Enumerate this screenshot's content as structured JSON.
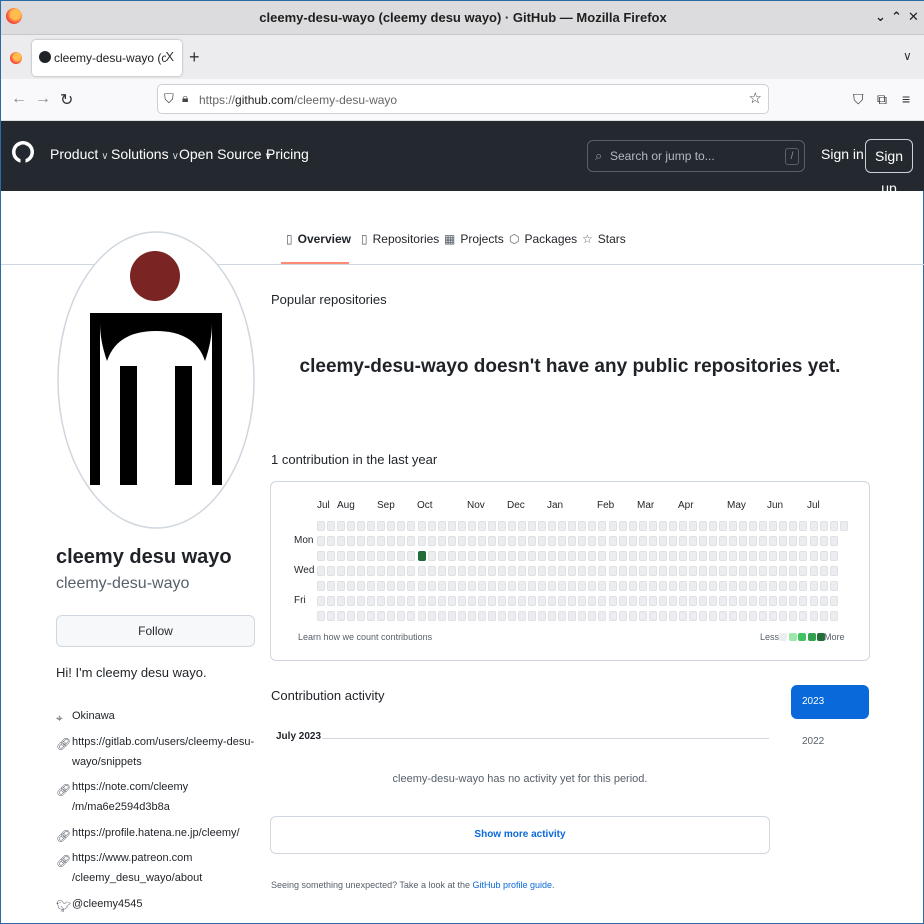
{
  "window": {
    "title": "cleemy-desu-wayo (cleemy desu wayo) · GitHub — Mozilla Firefox",
    "controls": [
      "⌄",
      "⌃",
      "✕"
    ]
  },
  "browser": {
    "tab_label": "cleemy-desu-wayo (cleemy desu",
    "tab_close": "X",
    "new_tab": "+",
    "url_prefix": "https://",
    "url_host": "github.com",
    "url_path": "/cleemy-desu-wayo"
  },
  "github_header": {
    "nav": [
      "Product",
      "Solutions",
      "Open Source",
      "Pricing"
    ],
    "search_placeholder": "Search or jump to...",
    "search_key": "/",
    "sign_in": "Sign in",
    "sign_up": "Sign up"
  },
  "profile_tabs": [
    "Overview",
    "Repositories",
    "Projects",
    "Packages",
    "Stars"
  ],
  "profile": {
    "name": "cleemy desu wayo",
    "login": "cleemy-desu-wayo",
    "follow": "Follow",
    "bio": "Hi! I'm cleemy desu wayo.",
    "location": "Okinawa",
    "links": [
      [
        "https://gitlab.com/users/cleemy-desu-",
        "wayo/snippets"
      ],
      [
        "https://note.com/cleemy",
        "/m/ma6e2594d3b8a"
      ],
      [
        "https://profile.hatena.ne.jp/cleemy/"
      ],
      [
        "https://www.patreon.com",
        "/cleemy_desu_wayo/about"
      ]
    ],
    "twitter": "@cleemy4545",
    "avatar_colors": {
      "head": "#7a2424",
      "body": "#000000"
    }
  },
  "popular": {
    "title": "Popular repositories",
    "empty": "cleemy-desu-wayo doesn't have any public repositories yet."
  },
  "contributions": {
    "title": "1 contribution in the last year",
    "months": [
      "Jul",
      "Aug",
      "Sep",
      "Oct",
      "Nov",
      "Dec",
      "Jan",
      "Feb",
      "Mar",
      "Apr",
      "May",
      "Jun",
      "Jul"
    ],
    "days": [
      "Mon",
      "Wed",
      "Fri"
    ],
    "weeks": 53,
    "contribution_day": {
      "week": 10,
      "day": 2,
      "count": 1
    },
    "learn": "Learn how we count contributions",
    "less": "Less",
    "more": "More",
    "colors": [
      "#ebedf0",
      "#9be9a8",
      "#40c463",
      "#30a14e",
      "#216e39"
    ]
  },
  "activity": {
    "title": "Contribution activity",
    "years": [
      "2023",
      "2022"
    ],
    "month_label": "July 2023",
    "none": "cleemy-desu-wayo has no activity yet for this period.",
    "show_more": "Show more activity",
    "footer_text": "Seeing something unexpected? Take a look at the ",
    "footer_link": "GitHub profile guide",
    "footer_end": "."
  }
}
